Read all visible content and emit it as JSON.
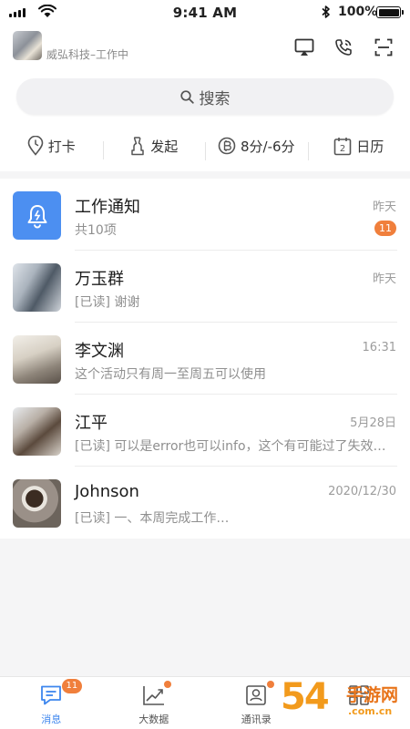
{
  "status_bar": {
    "time": "9:41 AM",
    "battery": "100%",
    "battery_level": 1.0
  },
  "header": {
    "company_status": "威弘科技–工作中",
    "search_placeholder": "搜索",
    "quick_actions": [
      {
        "icon": "location-pin-icon",
        "label": "打卡"
      },
      {
        "icon": "microphone-icon",
        "label": "发起"
      },
      {
        "icon": "coin-icon",
        "label": "8分/-6分"
      },
      {
        "icon": "calendar-icon",
        "label": "日历",
        "icon_text": "2"
      }
    ]
  },
  "conversations": [
    {
      "name": "工作通知",
      "preview": "共10项",
      "time": "昨天",
      "badge": "11",
      "avatar": "bell-icon"
    },
    {
      "name": "万玉群",
      "preview": "[已读] 谢谢",
      "time": "昨天",
      "avatar": "photo"
    },
    {
      "name": "李文渊",
      "preview": "这个活动只有周一至周五可以使用",
      "time": "16:31",
      "avatar": "photo"
    },
    {
      "name": "江平",
      "preview": "[已读] 可以是error也可以info，这个有可能过了失效…",
      "time": "5月28日",
      "avatar": "photo"
    },
    {
      "name": "Johnson",
      "preview": "[已读] 一、本周完成工作…",
      "time": "2020/12/30",
      "avatar": "photo"
    }
  ],
  "tab_bar": {
    "tabs": [
      {
        "label": "消息",
        "badge": "11",
        "active": true
      },
      {
        "label": "大数据",
        "dot": true
      },
      {
        "label": "通讯录"
      },
      {
        "label": ""
      }
    ]
  },
  "watermark": {
    "number": "54",
    "mid": "游",
    "brand": "手游网",
    "domain": ".com.cn"
  },
  "colors": {
    "accent": "#3d86ee",
    "badge": "#f07f3c",
    "bell_tile": "#4c8ff1"
  }
}
